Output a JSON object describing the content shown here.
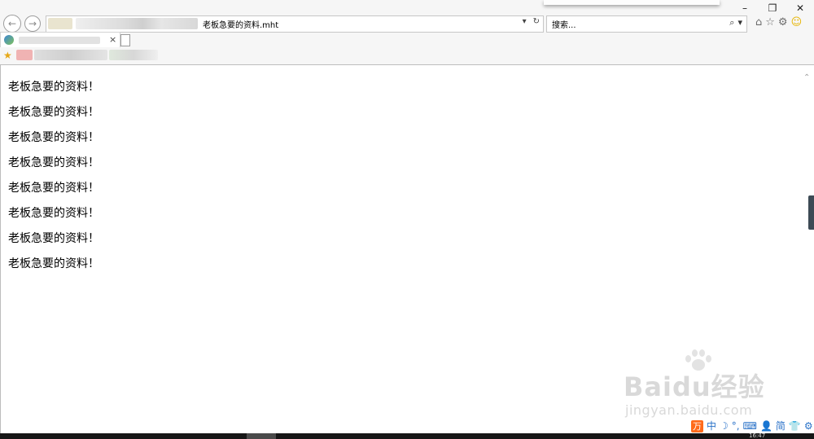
{
  "window": {
    "minimize": "–",
    "restore": "❐",
    "close": "✕"
  },
  "address_bar": {
    "text": "老板急要的资料.mht",
    "dropdown_icon": "▾",
    "refresh_icon": "↻"
  },
  "search": {
    "placeholder": "搜索...",
    "search_icon": "⌕",
    "dropdown_icon": "▾"
  },
  "toolbar_icons": {
    "home": "⌂",
    "favorites": "☆",
    "settings": "⚙",
    "feedback": "☺"
  },
  "tab": {
    "close": "×"
  },
  "content": {
    "lines": [
      "老板急要的资料！",
      "老板急要的资料！",
      "老板急要的资料！",
      "老板急要的资料！",
      "老板急要的资料！",
      "老板急要的资料！",
      "老板急要的资料！",
      "老板急要的资料！"
    ]
  },
  "watermark": {
    "main": "Baidu经验",
    "sub": "jingyan.baidu.com"
  },
  "ime": {
    "logo": "万",
    "mode": "中",
    "moon": "☽",
    "punct": "°,",
    "keyboard": "⌨",
    "user": "👤",
    "simplified": "简",
    "skin": "👕",
    "settings": "⚙"
  },
  "taskbar": {
    "clock": "16:47"
  },
  "colors": {
    "chrome_bg": "#f6f6f6",
    "ime_accent": "#2a72c8",
    "ime_logo": "#ff6a1a",
    "taskbar": "#161616"
  }
}
